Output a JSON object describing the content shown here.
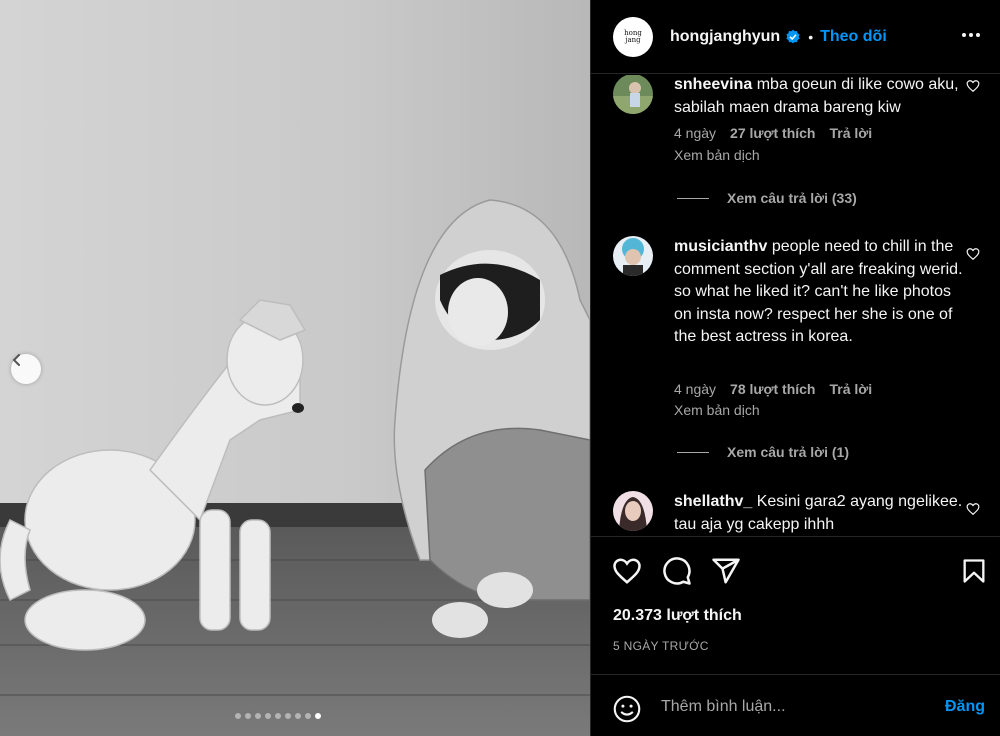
{
  "post": {
    "author": "hongjanghyun",
    "avatar_text": "hong\njang",
    "separator": "•",
    "follow_label": "Theo dõi",
    "likes": "20.373 lượt thích",
    "time_ago": "5 NGÀY TRƯỚC"
  },
  "carousel": {
    "slide_count": 9,
    "active_index": 8
  },
  "comments": [
    {
      "user": "snheevina",
      "text": "mba goeun di like cowo aku, sabilah maen drama bareng kiw",
      "age": "4 ngày",
      "likes": "27 lượt thích",
      "reply": "Trả lời",
      "translate": "Xem bản dịch",
      "view_replies": "Xem câu trả lời (33)"
    },
    {
      "user": "musicianthv",
      "text": "people need to chill in the comment section y'all are freaking werid. so what he liked it? can't he like photos on insta now? respect her she is one of the best actress in korea.",
      "age": "4 ngày",
      "likes": "78 lượt thích",
      "reply": "Trả lời",
      "translate": "Xem bản dịch",
      "view_replies": "Xem câu trả lời (1)"
    },
    {
      "user": "shellathv_",
      "text": "Kesini gara2 ayang ngelikee. tau aja yg cakepp ihhh"
    }
  ],
  "composer": {
    "placeholder": "Thêm bình luận...",
    "post_label": "Đăng"
  },
  "icons": {
    "verified": "verified-badge-icon",
    "more": "more-options-icon",
    "like": "heart-icon",
    "comment": "comment-bubble-icon",
    "share": "paper-plane-icon",
    "save": "bookmark-icon",
    "emoji": "emoji-icon",
    "prev": "chevron-left-icon"
  },
  "colors": {
    "accent": "#0095f6",
    "secondary_text": "#a8a8a8",
    "border": "#262626",
    "background": "#000000"
  }
}
